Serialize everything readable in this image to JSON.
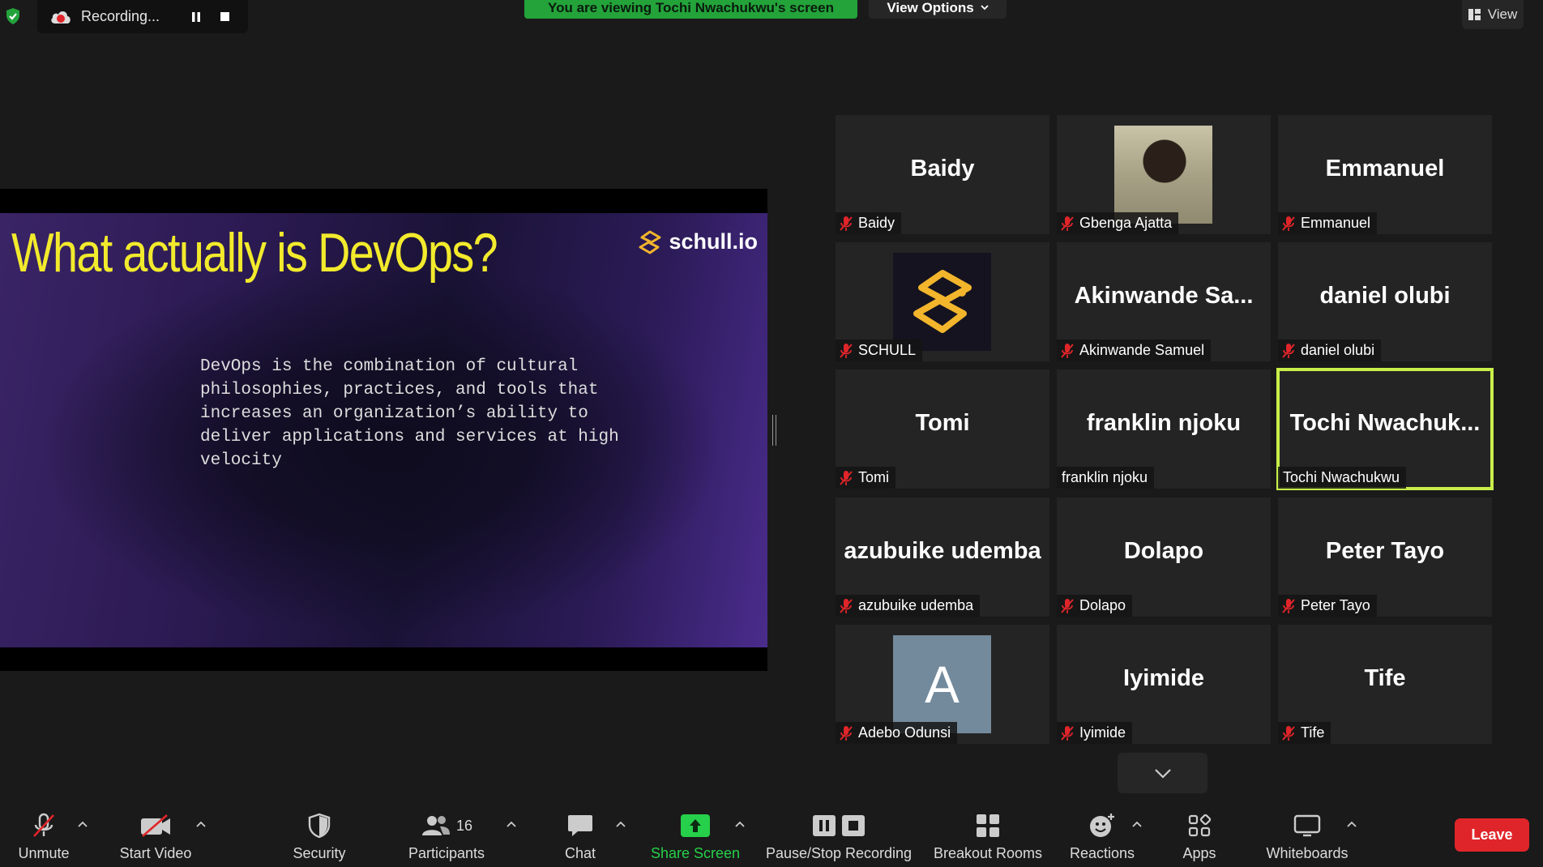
{
  "top_bar": {
    "recording_label": "Recording...",
    "viewing_banner": "You are viewing Tochi Nwachukwu's screen",
    "view_options_label": "View Options",
    "view_label": "View"
  },
  "slide": {
    "title": "What actually is DevOps?",
    "logo_text": "schull.io",
    "body": "DevOps is the combination of cultural philosophies, practices, and tools that increases an organization’s ability to deliver applications and services at high velocity"
  },
  "participants": [
    {
      "display": "Baidy",
      "label": "Baidy",
      "muted": true
    },
    {
      "display": "",
      "label": "Gbenga Ajatta",
      "muted": true,
      "avatar": "photo"
    },
    {
      "display": "Emmanuel",
      "label": "Emmanuel",
      "muted": true
    },
    {
      "display": "",
      "label": "SCHULL",
      "muted": true,
      "avatar": "schull-logo"
    },
    {
      "display": "Akinwande  Sa...",
      "label": "Akinwande Samuel",
      "muted": true
    },
    {
      "display": "daniel olubi",
      "label": "daniel olubi",
      "muted": true
    },
    {
      "display": "Tomi",
      "label": "Tomi",
      "muted": true
    },
    {
      "display": "franklin njoku",
      "label": "franklin njoku",
      "muted": false
    },
    {
      "display": "Tochi  Nwachuk...",
      "label": "Tochi Nwachukwu",
      "muted": false,
      "active_speaker": true
    },
    {
      "display": "azubuike udemba",
      "label": "azubuike udemba",
      "muted": true
    },
    {
      "display": "Dolapo",
      "label": "Dolapo",
      "muted": true
    },
    {
      "display": "Peter Tayo",
      "label": "Peter Tayo",
      "muted": true
    },
    {
      "display": "",
      "label": "Adebo Odunsi",
      "muted": true,
      "avatar": "letter",
      "avatar_letter": "A"
    },
    {
      "display": "Iyimide",
      "label": "Iyimide",
      "muted": true
    },
    {
      "display": "Tife",
      "label": "Tife",
      "muted": true
    }
  ],
  "toolbar": {
    "unmute": "Unmute",
    "start_video": "Start Video",
    "security": "Security",
    "participants": "Participants",
    "participants_count": "16",
    "chat": "Chat",
    "share_screen": "Share Screen",
    "pause_stop_recording": "Pause/Stop Recording",
    "breakout_rooms": "Breakout Rooms",
    "reactions": "Reactions",
    "apps": "Apps",
    "whiteboards": "Whiteboards",
    "leave": "Leave"
  },
  "colors": {
    "accent_green": "#23a33a",
    "leave_red": "#e0252a",
    "active_speaker_border": "#c8ef4a",
    "slide_title": "#f2ea2c"
  }
}
